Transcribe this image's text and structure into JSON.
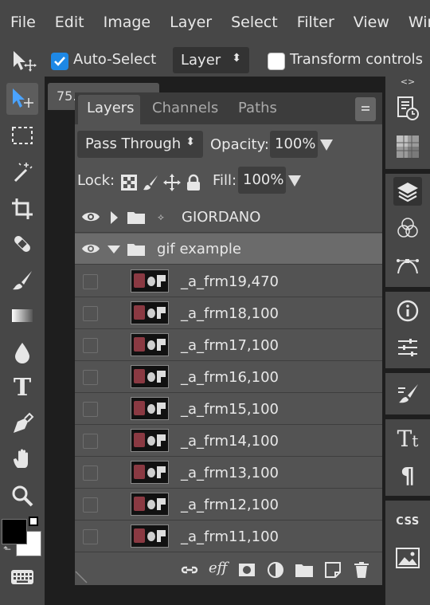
{
  "menubar": {
    "items": [
      "File",
      "Edit",
      "Image",
      "Layer",
      "Select",
      "Filter",
      "View",
      "Wind"
    ]
  },
  "options": {
    "auto_select_label": "Auto-Select",
    "auto_select_checked": true,
    "target_value": "Layer",
    "transform_label": "Transform controls",
    "transform_checked": false
  },
  "document": {
    "tab_label": "75."
  },
  "dock": {
    "collapse_label": "<>"
  },
  "panel": {
    "tabs": [
      "Layers",
      "Channels",
      "Paths"
    ],
    "active_tab": "Layers",
    "blend_mode": "Pass Through",
    "opacity_label": "Opacity:",
    "opacity_value": "100%",
    "lock_label": "Lock:",
    "fill_label": "Fill:",
    "fill_value": "100%",
    "groups": [
      {
        "name": "GIORDANO",
        "expanded": false,
        "visible": true
      },
      {
        "name": "gif example",
        "expanded": true,
        "visible": true
      }
    ],
    "layers": [
      {
        "name": "_a_frm19,470"
      },
      {
        "name": "_a_frm18,100"
      },
      {
        "name": "_a_frm17,100"
      },
      {
        "name": "_a_frm16,100"
      },
      {
        "name": "_a_frm15,100"
      },
      {
        "name": "_a_frm14,100"
      },
      {
        "name": "_a_frm13,100"
      },
      {
        "name": "_a_frm12,100"
      },
      {
        "name": "_a_frm11,100"
      }
    ],
    "footer_fx_label": "eff"
  },
  "colors": {
    "accent": "#1e88e5",
    "panel_bg": "#535353",
    "selected_row": "#6b6b6b"
  }
}
